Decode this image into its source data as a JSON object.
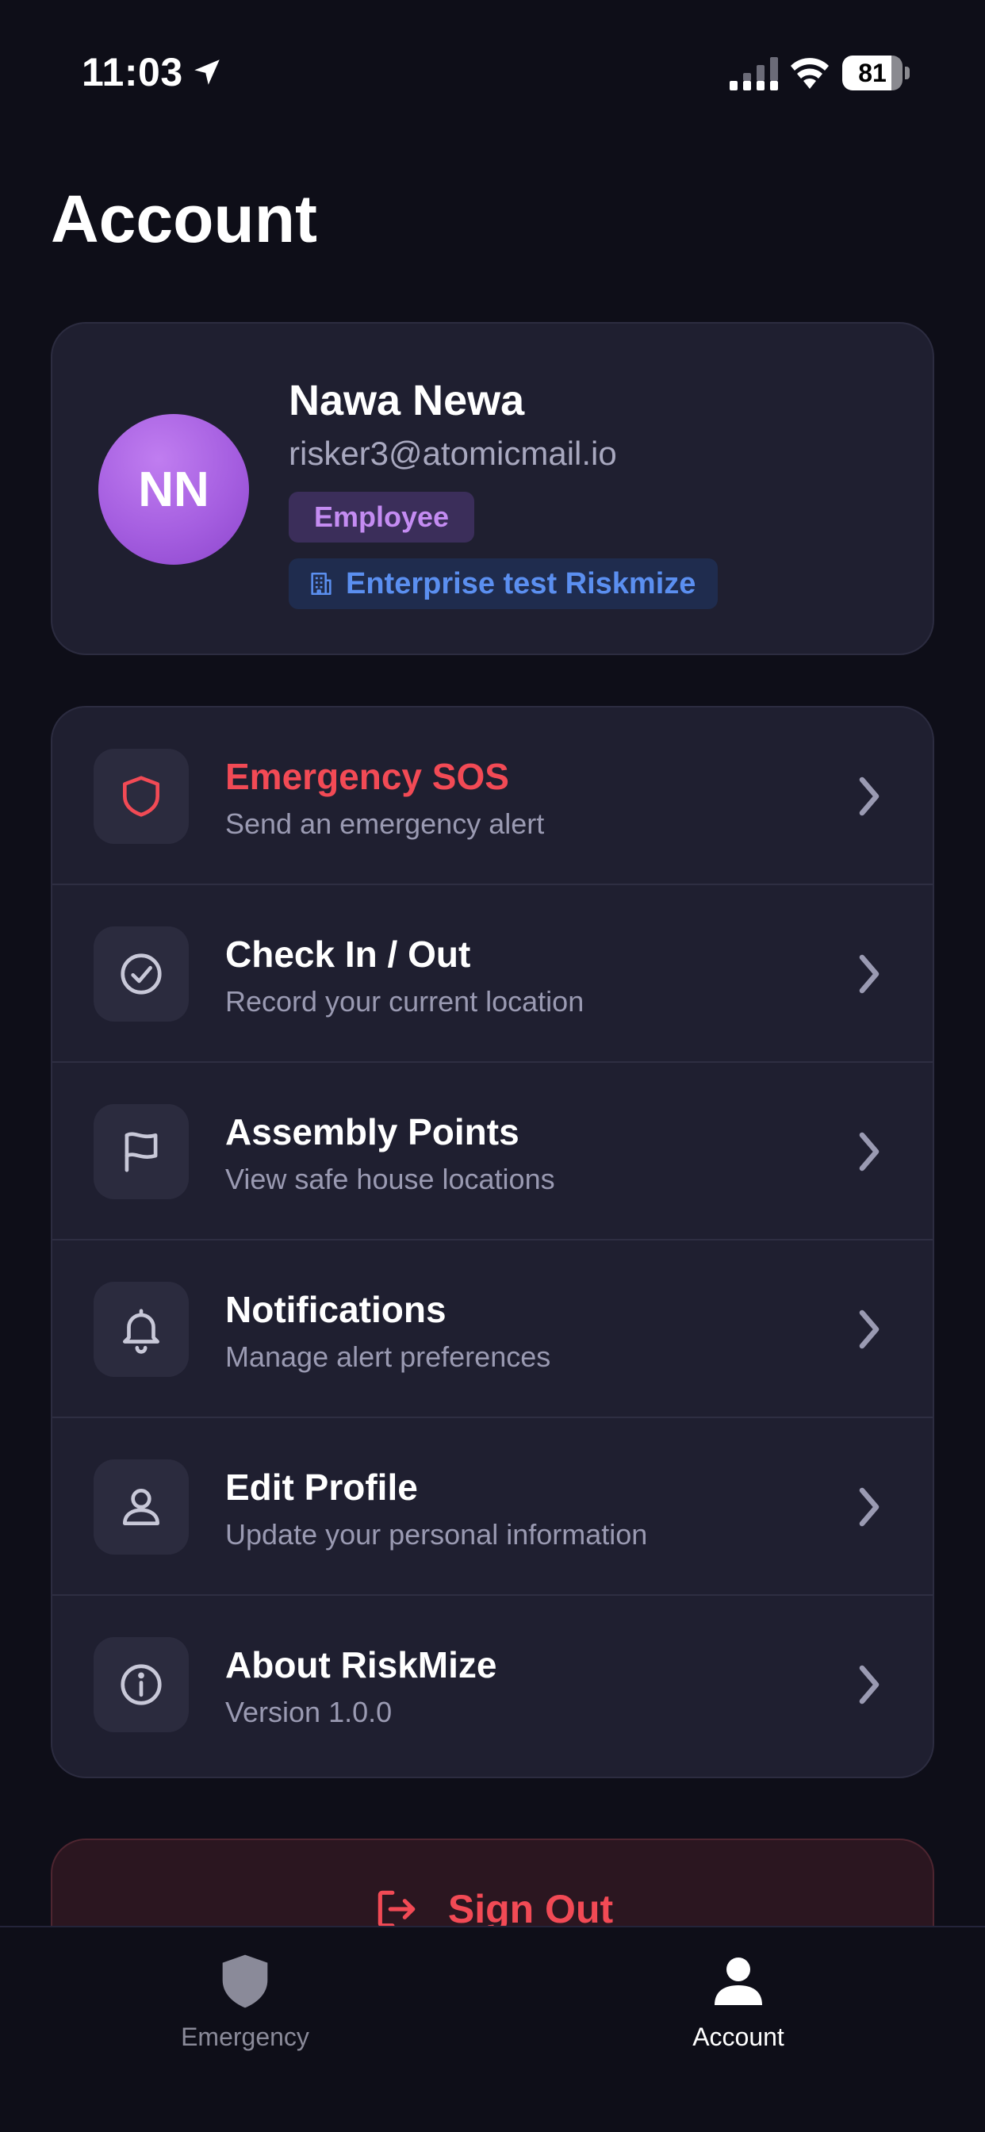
{
  "status_bar": {
    "time": "11:03",
    "battery": "81",
    "battery_level_percent": 81,
    "icons": [
      "location-arrow-icon",
      "cellular-signal-icon",
      "wifi-icon",
      "battery-icon"
    ]
  },
  "header": {
    "title": "Account"
  },
  "profile": {
    "initials": "NN",
    "name": "Nawa Newa",
    "email": "risker3@atomicmail.io",
    "role": "Employee",
    "organization": "Enterprise test Riskmize",
    "avatar_color": "#a55ee0"
  },
  "menu": {
    "items": [
      {
        "title": "Emergency SOS",
        "subtitle": "Send an emergency alert",
        "icon": "shield-icon",
        "danger": true
      },
      {
        "title": "Check In / Out",
        "subtitle": "Record your current location",
        "icon": "check-circle-icon"
      },
      {
        "title": "Assembly Points",
        "subtitle": "View safe house locations",
        "icon": "flag-icon"
      },
      {
        "title": "Notifications",
        "subtitle": "Manage alert preferences",
        "icon": "bell-icon"
      },
      {
        "title": "Edit Profile",
        "subtitle": "Update your personal information",
        "icon": "user-icon"
      },
      {
        "title": "About RiskMize",
        "subtitle": "Version 1.0.0",
        "icon": "info-icon"
      }
    ]
  },
  "sign_out": {
    "label": "Sign Out",
    "icon": "logout-icon"
  },
  "tab_bar": {
    "tabs": [
      {
        "label": "Emergency",
        "icon": "shield-icon",
        "active": false
      },
      {
        "label": "Account",
        "icon": "person-icon",
        "active": true
      }
    ]
  },
  "colors": {
    "background": "#0e0e18",
    "card": "#1f1f30",
    "danger": "#f24a55",
    "role_badge_text": "#c48cf2",
    "org_badge_text": "#5b8ff0"
  }
}
